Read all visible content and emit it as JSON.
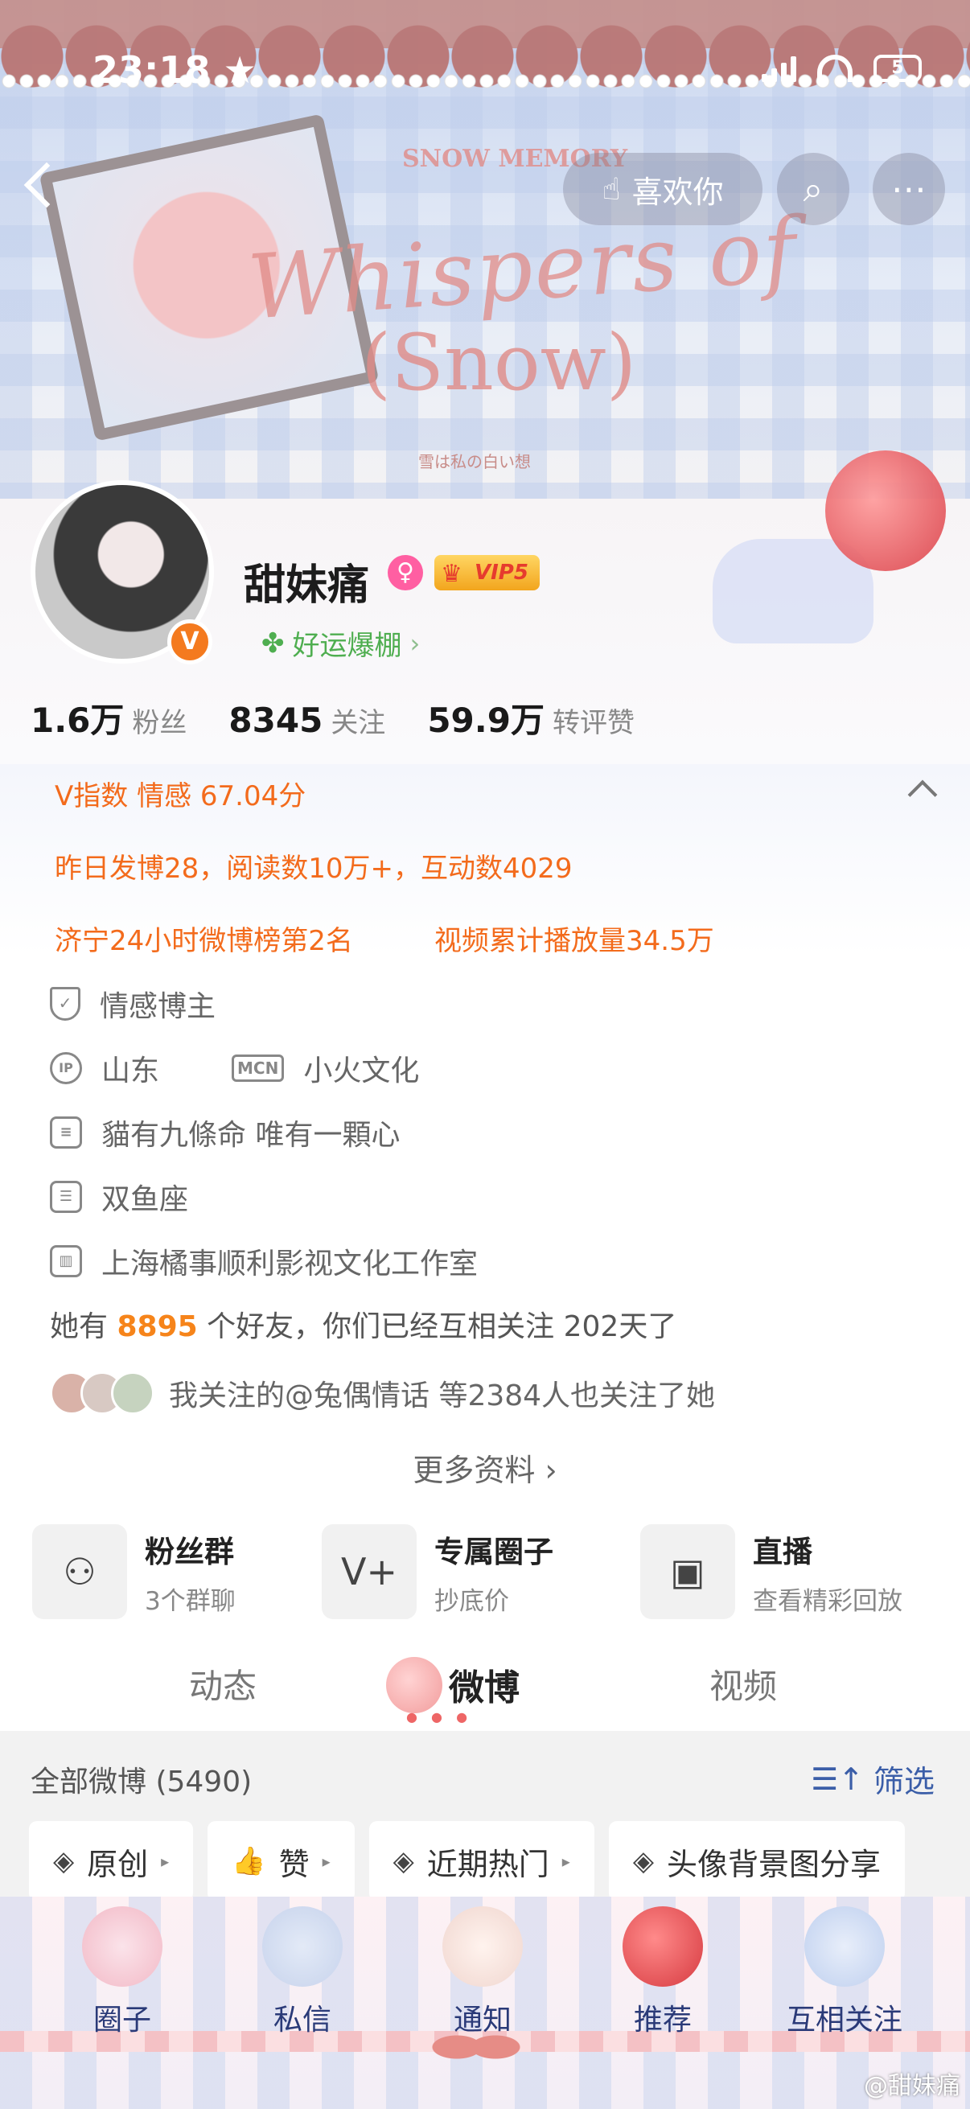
{
  "status": {
    "time": "23:18",
    "battery": "5"
  },
  "banner": {
    "small": "SNOW MEMORY",
    "title": "Whispers of",
    "subtitle": "(Snow)",
    "caption": "雪は私の白い想"
  },
  "nav": {
    "like_label": "喜欢你"
  },
  "profile": {
    "name": "甜妹痛",
    "vip": "VIP5",
    "luck": "好运爆棚",
    "stats": [
      {
        "num": "1.6万",
        "label": "粉丝"
      },
      {
        "num": "8345",
        "label": "关注"
      },
      {
        "num": "59.9万",
        "label": "转评赞"
      }
    ]
  },
  "vindex": {
    "text": "V指数 情感 67.04分"
  },
  "highlights": {
    "line1": "昨日发博28，阅读数10万+，互动数4029",
    "rank": "济宁24小时微博榜第2名",
    "video": "视频累计播放量34.5万"
  },
  "info": {
    "role": "情感博主",
    "ip_icon": "IP",
    "location": "山东",
    "mcn_icon": "MCN",
    "mcn": "小火文化",
    "bio": "貓有九條命 唯有一顆心",
    "sign": "双鱼座",
    "company": "上海橘事顺利影视文化工作室"
  },
  "friends": {
    "prefix": "她有",
    "count": "8895",
    "suffix": "个好友，你们已经互相关注",
    "days": "202",
    "tail": "天了"
  },
  "mutual": {
    "text": "我关注的@兔偶情话 等2384人也关注了她"
  },
  "more_info": "更多资料",
  "quick_actions": [
    {
      "title": "粉丝群",
      "sub": "3个群聊",
      "icon": "group-icon"
    },
    {
      "title": "专属圈子",
      "sub": "抄底价",
      "icon": "v-plus-icon"
    },
    {
      "title": "直播",
      "sub": "查看精彩回放",
      "icon": "tv-icon"
    }
  ],
  "tabs": [
    "动态",
    "微博",
    "视频"
  ],
  "feed": {
    "title": "全部微博 (5490)",
    "filter": "筛选",
    "chips": [
      "原创",
      "赞",
      "近期热门",
      "头像背景图分享"
    ]
  },
  "bottom_nav": [
    "圈子",
    "私信",
    "通知",
    "推荐",
    "互相关注"
  ],
  "watermark": "@甜妹痛",
  "colors": {
    "orange": "#f36b1c",
    "friend_highlight": "#f6841a",
    "filter_blue": "#3b5ea8",
    "nav_text": "#2a3a78"
  }
}
